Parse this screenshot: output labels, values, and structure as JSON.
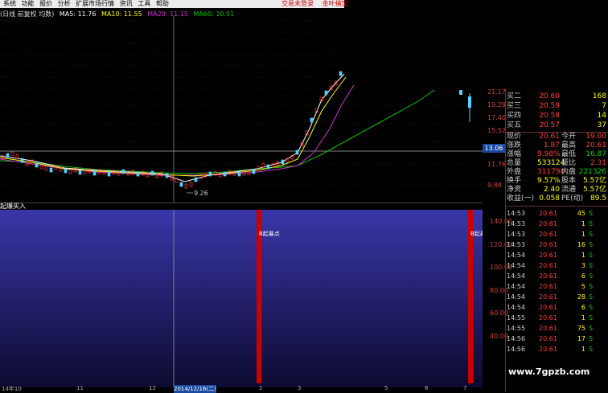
{
  "menu": {
    "items": [
      "系统",
      "功能",
      "报价",
      "分析",
      "扩展市场行情",
      "资讯",
      "工具",
      "帮助"
    ],
    "right_items": [
      "交易未登录",
      "金叶捕宝"
    ]
  },
  "indicator_line": {
    "name": "(日线 前复权 均数)",
    "ma5": "MA5: 11.76",
    "ma10": "MA10: 11.55",
    "ma20": "MA20: 11.15",
    "ma60": "MA60: 10.91"
  },
  "colors": {
    "ma5": "#ffffff",
    "ma10": "#ffff00",
    "ma20": "#d030d0",
    "ma60": "#00c000",
    "up": "#ff3b3b",
    "down": "#55d0ff",
    "signal": "#cc0000",
    "sub_bg": "#2a2a8a"
  },
  "main_chart": {
    "low_marker": "9.26",
    "right_axis": [
      "21.17",
      "19.29",
      "17.40",
      "15.52",
      "13.06",
      "11.76",
      "9.88"
    ],
    "current_price_tag": "13.06"
  },
  "sub_chart": {
    "label": "起爆买入",
    "signal_labels": [
      "B起暴点",
      "B起暴"
    ],
    "right_axis": [
      "140.00",
      "120.00",
      "100.00",
      "80.00",
      "60.00",
      "40.00"
    ]
  },
  "bottom_axis": [
    "14年10",
    "11",
    "12",
    "2014/12/16(二)",
    "2",
    "3",
    "5",
    "6",
    "7"
  ],
  "quote_panel": {
    "rows": [
      {
        "label": "买二",
        "value": "20.60",
        "vol": "168"
      },
      {
        "label": "买三",
        "value": "20.59",
        "vol": "7"
      },
      {
        "label": "买四",
        "value": "20.58",
        "vol": "14"
      },
      {
        "label": "买五",
        "value": "20.57",
        "vol": "37"
      }
    ],
    "stats": [
      {
        "l1": "现价",
        "v1": "20.61",
        "l2": "今开",
        "v2": "19.00"
      },
      {
        "l1": "涨跌",
        "v1": "1.87",
        "l2": "最高",
        "v2": "20.61"
      },
      {
        "l1": "涨幅",
        "v1": "9.98%",
        "l2": "最低",
        "v2": "16.87"
      },
      {
        "l1": "总量",
        "v1": "533124",
        "l2": "量比",
        "v2": "2.31"
      },
      {
        "l1": "外盘",
        "v1": "311798",
        "l2": "内盘",
        "v2": "221326"
      },
      {
        "l1": "换手",
        "v1": "9.57%",
        "l2": "股本",
        "v2": "5.57亿"
      },
      {
        "l1": "净资",
        "v1": "2.40",
        "l2": "流通",
        "v2": "5.57亿"
      },
      {
        "l1": "收益(一)",
        "v1": "0.058",
        "l2": "PE(动)",
        "v2": "89.5"
      }
    ]
  },
  "trades": [
    {
      "time": "14:53",
      "price": "20.61",
      "qty": "45",
      "side": "S"
    },
    {
      "time": "14:53",
      "price": "20.61",
      "qty": "1",
      "side": "S"
    },
    {
      "time": "14:53",
      "price": "20.61",
      "qty": "1",
      "side": "S"
    },
    {
      "time": "14:53",
      "price": "20.61",
      "qty": "16",
      "side": "S"
    },
    {
      "time": "14:54",
      "price": "20.61",
      "qty": "1",
      "side": "S"
    },
    {
      "time": "14:54",
      "price": "20.61",
      "qty": "3",
      "side": "S"
    },
    {
      "time": "14:54",
      "price": "20.61",
      "qty": "6",
      "side": "S"
    },
    {
      "time": "14:54",
      "price": "20.61",
      "qty": "5",
      "side": "S"
    },
    {
      "time": "14:54",
      "price": "20.61",
      "qty": "28",
      "side": "S"
    },
    {
      "time": "14:54",
      "price": "20.61",
      "qty": "6",
      "side": "S"
    },
    {
      "time": "14:55",
      "price": "20.61",
      "qty": "1",
      "side": "S"
    },
    {
      "time": "14:55",
      "price": "20.61",
      "qty": "75",
      "side": "S"
    },
    {
      "time": "14:56",
      "price": "20.61",
      "qty": "17",
      "side": "S"
    },
    {
      "time": "14:56",
      "price": "20.61",
      "qty": "1",
      "side": "S"
    }
  ],
  "watermark": "www.7gpzb.com"
}
